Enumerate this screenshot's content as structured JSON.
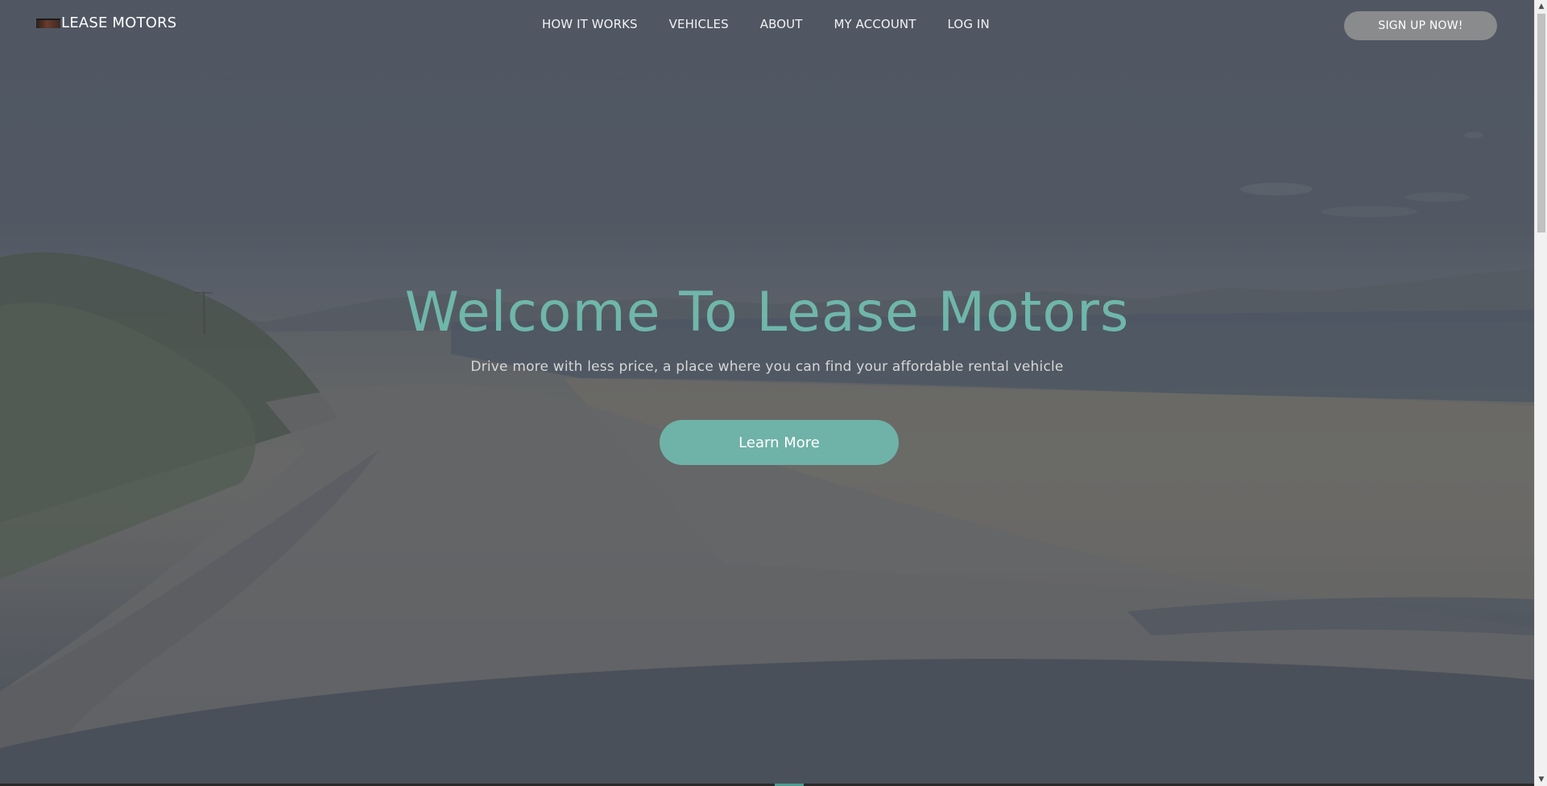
{
  "nav": {
    "brand": "LEASE MOTORS",
    "menu": [
      {
        "label": "HOW IT WORKS"
      },
      {
        "label": "VEHICLES"
      },
      {
        "label": "ABOUT"
      },
      {
        "label": "MY ACCOUNT"
      },
      {
        "label": "LOG IN"
      }
    ],
    "signup_label": "SIGN UP NOW!"
  },
  "hero": {
    "title": "Welcome To Lease Motors",
    "subtitle": "Drive more with less price, a place where you can find your affordable rental vehicle",
    "cta_label": "Learn More"
  },
  "colors": {
    "accent": "#6fb2a8",
    "title": "#6fb6ab",
    "signup_bg": "#8a8b8d"
  },
  "icons": {
    "brand_logo": "car-logo-image",
    "scroll_up": "scroll-up-arrow-icon",
    "scroll_down": "scroll-down-arrow-icon"
  }
}
